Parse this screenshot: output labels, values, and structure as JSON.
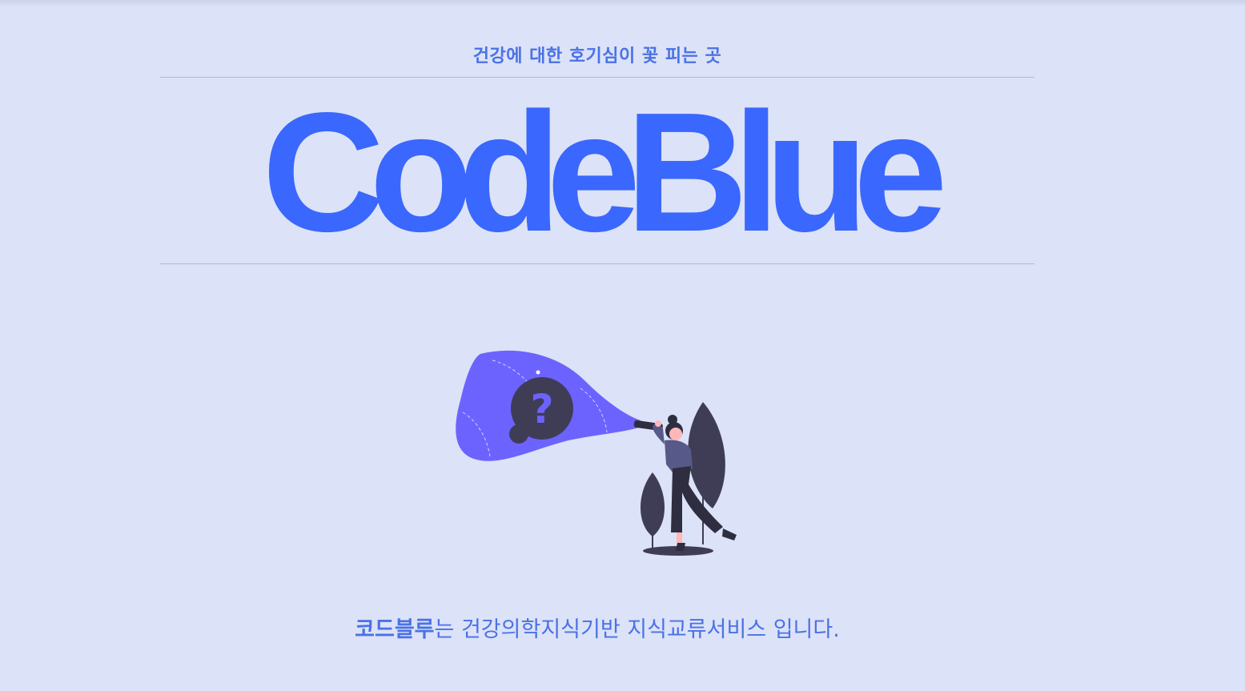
{
  "header": {
    "tagline": "건강에 대한 호기심이 꽃 피는 곳"
  },
  "brand": {
    "logo_text": "CodeBlue",
    "color": "#3a67fd"
  },
  "illustration": {
    "icon": "question-mark-icon",
    "accent_color": "#6c63ff"
  },
  "footer": {
    "brand_name": "코드블루",
    "description": "는 건강의학지식기반 지식교류서비스 입니다."
  }
}
